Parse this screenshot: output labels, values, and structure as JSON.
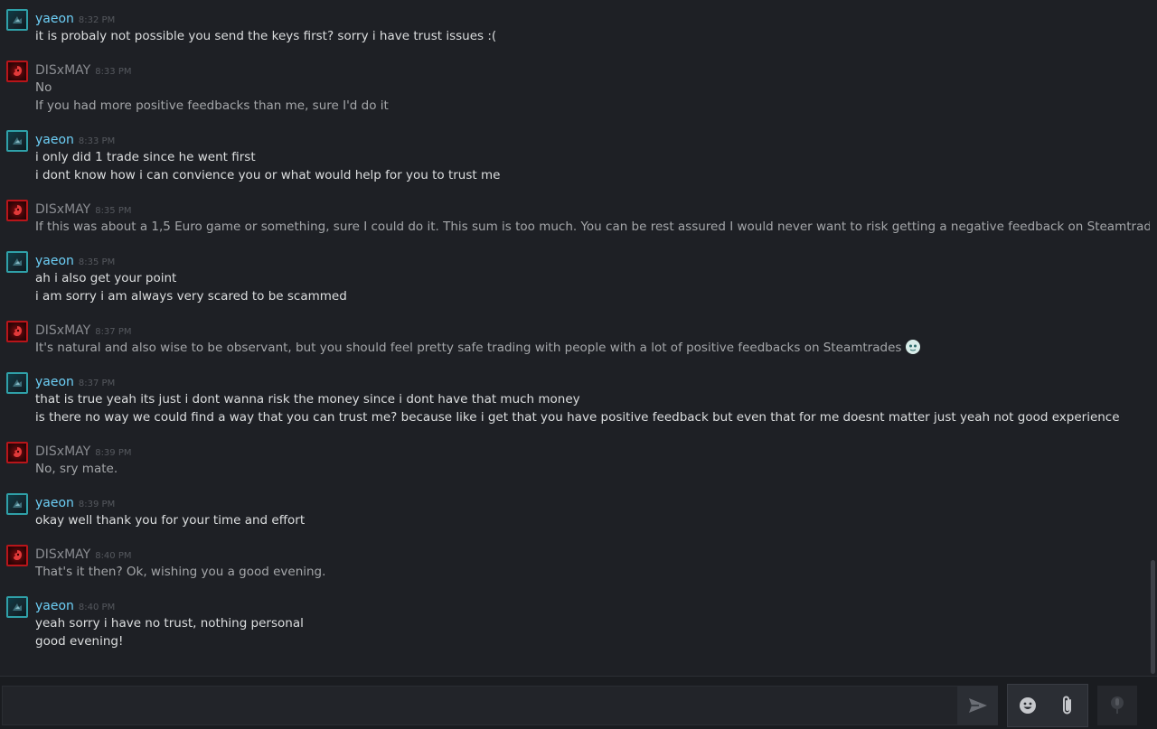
{
  "chat": {
    "messages": [
      {
        "sender": "yaeon",
        "role": "friend",
        "time": "8:32 PM",
        "lines": [
          "it is probaly not possible you send the keys first? sorry i have trust issues :("
        ]
      },
      {
        "sender": "DISxMAY",
        "role": "other",
        "time": "8:33 PM",
        "lines": [
          "No",
          "If you had more positive feedbacks than me, sure I'd do it"
        ]
      },
      {
        "sender": "yaeon",
        "role": "friend",
        "time": "8:33 PM",
        "lines": [
          "i only did 1 trade since he went first",
          "i dont know how i can convience you or what would help for you to trust me"
        ]
      },
      {
        "sender": "DISxMAY",
        "role": "other",
        "time": "8:35 PM",
        "lines": [
          "If this was about a 1,5 Euro game or something, sure I could do it. This sum is too much. You can be rest assured I would never want to risk getting a negative feedback on Steamtrades."
        ]
      },
      {
        "sender": "yaeon",
        "role": "friend",
        "time": "8:35 PM",
        "lines": [
          "ah i also get your point",
          "i am sorry i am always very scared to be scammed"
        ]
      },
      {
        "sender": "DISxMAY",
        "role": "other",
        "time": "8:37 PM",
        "lines": [
          "It's natural and also wise to be observant, but you should feel pretty safe trading with people with a lot of positive feedbacks on Steamtrades"
        ],
        "emoji": "ghost-emoticon"
      },
      {
        "sender": "yaeon",
        "role": "friend",
        "time": "8:37 PM",
        "lines": [
          "that is true yeah its just i dont wanna risk the money since i dont have that much money",
          "is there no way we could find a way that you can trust me? because like i get that you have positive feedback but even that for me doesnt matter just yeah not good experience"
        ]
      },
      {
        "sender": "DISxMAY",
        "role": "other",
        "time": "8:39 PM",
        "lines": [
          "No, sry mate."
        ]
      },
      {
        "sender": "yaeon",
        "role": "friend",
        "time": "8:39 PM",
        "lines": [
          "okay well thank you for your time and effort"
        ]
      },
      {
        "sender": "DISxMAY",
        "role": "other",
        "time": "8:40 PM",
        "lines": [
          "That's it then? Ok, wishing you a good evening."
        ]
      },
      {
        "sender": "yaeon",
        "role": "friend",
        "time": "8:40 PM",
        "lines": [
          "yeah sorry i have no trust, nothing personal",
          "good evening!"
        ]
      }
    ]
  },
  "entry": {
    "placeholder": "",
    "value": "",
    "icons": {
      "send": "send-icon",
      "emoji": "emoticon-icon",
      "attach": "paperclip-icon",
      "voice": "microphone-icon"
    }
  },
  "colors": {
    "friend_name": "#6dcff6",
    "other_name": "#8a8c91",
    "friend_text": "#dcdedf",
    "other_text": "#a4a6a9",
    "background": "#1e2025"
  }
}
